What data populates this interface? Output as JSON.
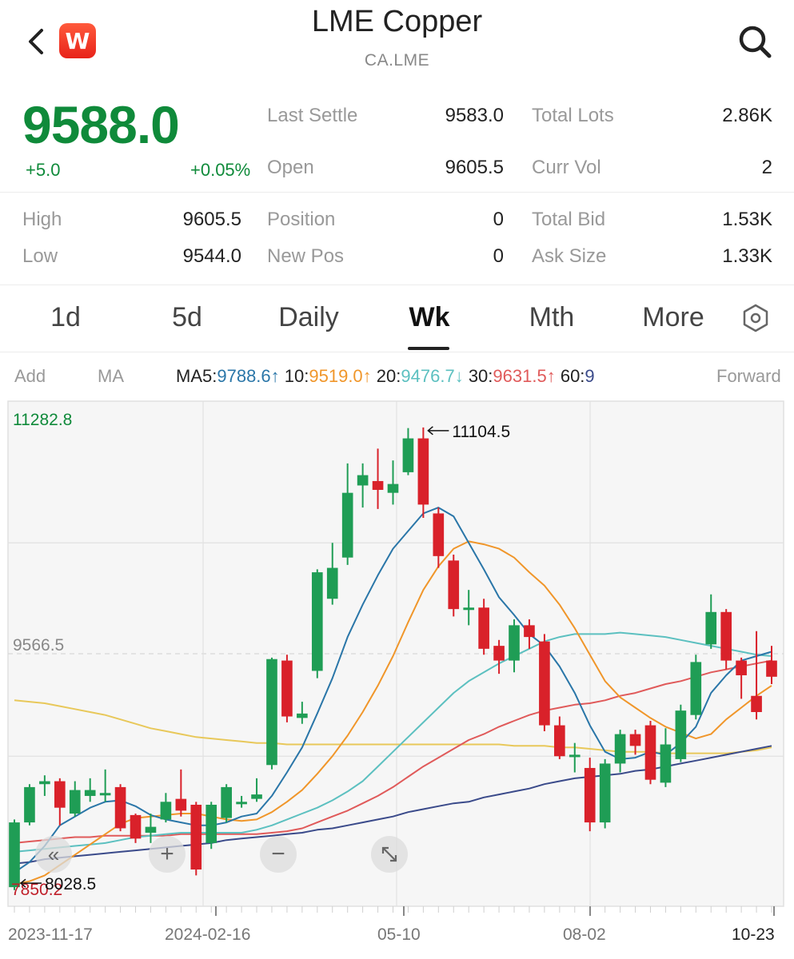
{
  "header": {
    "title": "LME Copper",
    "symbol": "CA.LME",
    "logo_letter": "W",
    "back_icon": "chevron-left-icon",
    "search_icon": "search-icon"
  },
  "quote": {
    "last_price": "9588.0",
    "change": "+5.0",
    "change_pct": "+0.05%",
    "price_color": "#0f8a3a"
  },
  "stats": {
    "last_settle_label": "Last Settle",
    "last_settle": "9583.0",
    "total_lots_label": "Total Lots",
    "total_lots": "2.86K",
    "open_label": "Open",
    "open": "9605.5",
    "curr_vol_label": "Curr Vol",
    "curr_vol": "2",
    "high_label": "High",
    "high": "9605.5",
    "position_label": "Position",
    "position": "0",
    "total_bid_label": "Total Bid",
    "total_bid": "1.53K",
    "low_label": "Low",
    "low": "9544.0",
    "new_pos_label": "New Pos",
    "new_pos": "0",
    "ask_size_label": "Ask Size",
    "ask_size": "1.33K"
  },
  "tabs": [
    "1d",
    "5d",
    "Daily",
    "Wk",
    "Mth",
    "More"
  ],
  "active_tab": "Wk",
  "ma_bar": {
    "add": "Add",
    "ma": "MA",
    "ma5_label": "MA5:",
    "ma5_value": "9788.6",
    "ma5_arrow": "↑",
    "ma10_label": "10:",
    "ma10_value": "9519.0",
    "ma10_arrow": "↑",
    "ma20_label": "20:",
    "ma20_value": "9476.7",
    "ma20_arrow": "↓",
    "ma30_label": "30:",
    "ma30_value": "9631.5",
    "ma30_arrow": "↑",
    "ma60_label": "60:",
    "ma60_value": "9",
    "forward": "Forward",
    "colors": {
      "ma5": "#2a76a8",
      "ma10": "#f0962a",
      "ma20": "#5cc0c0",
      "ma30": "#e05a5a",
      "ma60": "#3a4a8a",
      "ma_long": "#e8c85a"
    }
  },
  "chart_data": {
    "type": "candlestick",
    "ylim": [
      7850.2,
      11282.8
    ],
    "y_labels": {
      "top": "11282.8",
      "mid": "9566.5",
      "bottom": "7850.2"
    },
    "max_label": "11104.5",
    "min_label": "8028.5",
    "x_labels": [
      "2023-11-17",
      "2024-02-16",
      "05-10",
      "08-02",
      "10-23"
    ],
    "up_color": "#1f9d55",
    "down_color": "#d9212a",
    "candles": [
      {
        "o": 7980,
        "c": 8420,
        "h": 8440,
        "l": 7960
      },
      {
        "o": 8420,
        "c": 8660,
        "h": 8680,
        "l": 8400
      },
      {
        "o": 8680,
        "c": 8700,
        "h": 8740,
        "l": 8600
      },
      {
        "o": 8700,
        "c": 8520,
        "h": 8720,
        "l": 8400
      },
      {
        "o": 8480,
        "c": 8640,
        "h": 8700,
        "l": 8460
      },
      {
        "o": 8600,
        "c": 8640,
        "h": 8720,
        "l": 8560
      },
      {
        "o": 8620,
        "c": 8620,
        "h": 8780,
        "l": 8560
      },
      {
        "o": 8660,
        "c": 8380,
        "h": 8680,
        "l": 8360
      },
      {
        "o": 8470,
        "c": 8310,
        "h": 8480,
        "l": 8280
      },
      {
        "o": 8350,
        "c": 8390,
        "h": 8480,
        "l": 8280
      },
      {
        "o": 8440,
        "c": 8560,
        "h": 8620,
        "l": 8420
      },
      {
        "o": 8580,
        "c": 8500,
        "h": 8780,
        "l": 8460
      },
      {
        "o": 8540,
        "c": 8100,
        "h": 8560,
        "l": 8060
      },
      {
        "o": 8280,
        "c": 8540,
        "h": 8560,
        "l": 8240
      },
      {
        "o": 8450,
        "c": 8660,
        "h": 8680,
        "l": 8420
      },
      {
        "o": 8560,
        "c": 8560,
        "h": 8600,
        "l": 8520
      },
      {
        "o": 8580,
        "c": 8610,
        "h": 8720,
        "l": 8560
      },
      {
        "o": 8810,
        "c": 9530,
        "h": 9540,
        "l": 8780
      },
      {
        "o": 9520,
        "c": 9140,
        "h": 9560,
        "l": 9100
      },
      {
        "o": 9130,
        "c": 9160,
        "h": 9240,
        "l": 9090
      },
      {
        "o": 9450,
        "c": 10120,
        "h": 10140,
        "l": 9400
      },
      {
        "o": 9940,
        "c": 10150,
        "h": 10320,
        "l": 9900
      },
      {
        "o": 10220,
        "c": 10660,
        "h": 10860,
        "l": 10170
      },
      {
        "o": 10710,
        "c": 10780,
        "h": 10860,
        "l": 10560
      },
      {
        "o": 10740,
        "c": 10680,
        "h": 10960,
        "l": 10550
      },
      {
        "o": 10660,
        "c": 10720,
        "h": 10880,
        "l": 10580
      },
      {
        "o": 10800,
        "c": 11030,
        "h": 11100,
        "l": 10780
      },
      {
        "o": 11030,
        "c": 10580,
        "h": 11104.5,
        "l": 10490
      },
      {
        "o": 10520,
        "c": 10230,
        "h": 10560,
        "l": 10150
      },
      {
        "o": 10200,
        "c": 9870,
        "h": 10240,
        "l": 9820
      },
      {
        "o": 9880,
        "c": 9880,
        "h": 10000,
        "l": 9760
      },
      {
        "o": 9880,
        "c": 9600,
        "h": 9940,
        "l": 9560
      },
      {
        "o": 9620,
        "c": 9520,
        "h": 9660,
        "l": 9430
      },
      {
        "o": 9520,
        "c": 9760,
        "h": 9800,
        "l": 9440
      },
      {
        "o": 9760,
        "c": 9680,
        "h": 9800,
        "l": 9600
      },
      {
        "o": 9650,
        "c": 9080,
        "h": 9700,
        "l": 9040
      },
      {
        "o": 9080,
        "c": 8870,
        "h": 9140,
        "l": 8850
      },
      {
        "o": 8880,
        "c": 8880,
        "h": 8960,
        "l": 8760
      },
      {
        "o": 8790,
        "c": 8420,
        "h": 8860,
        "l": 8360
      },
      {
        "o": 8420,
        "c": 8820,
        "h": 8850,
        "l": 8380
      },
      {
        "o": 8820,
        "c": 9020,
        "h": 9050,
        "l": 8760
      },
      {
        "o": 9020,
        "c": 8940,
        "h": 9050,
        "l": 8880
      },
      {
        "o": 9080,
        "c": 8710,
        "h": 9110,
        "l": 8680
      },
      {
        "o": 8690,
        "c": 8950,
        "h": 9060,
        "l": 8660
      },
      {
        "o": 8850,
        "c": 9180,
        "h": 9220,
        "l": 8830
      },
      {
        "o": 9150,
        "c": 9510,
        "h": 9560,
        "l": 9120
      },
      {
        "o": 9630,
        "c": 9850,
        "h": 9970,
        "l": 9600
      },
      {
        "o": 9850,
        "c": 9520,
        "h": 9870,
        "l": 9460
      },
      {
        "o": 9520,
        "c": 9420,
        "h": 9540,
        "l": 9260
      },
      {
        "o": 9280,
        "c": 9170,
        "h": 9720,
        "l": 9120
      },
      {
        "o": 9520,
        "c": 9410,
        "h": 9620,
        "l": 9360
      }
    ],
    "ma5": [
      8080,
      8150,
      8260,
      8400,
      8460,
      8520,
      8560,
      8570,
      8530,
      8470,
      8440,
      8420,
      8400,
      8400,
      8420,
      8460,
      8480,
      8600,
      8760,
      8930,
      9160,
      9400,
      9680,
      9900,
      10100,
      10280,
      10400,
      10520,
      10560,
      10500,
      10320,
      10140,
      9950,
      9830,
      9700,
      9620,
      9480,
      9300,
      9080,
      8900,
      8850,
      8860,
      8900,
      8880,
      8960,
      9070,
      9300,
      9420,
      9520,
      9550,
      9580
    ],
    "ma10": [
      8000,
      8020,
      8060,
      8130,
      8200,
      8270,
      8340,
      8410,
      8450,
      8460,
      8470,
      8480,
      8480,
      8460,
      8440,
      8430,
      8440,
      8490,
      8560,
      8640,
      8750,
      8870,
      9010,
      9170,
      9350,
      9550,
      9780,
      10000,
      10160,
      10280,
      10330,
      10310,
      10280,
      10220,
      10120,
      10030,
      9900,
      9740,
      9560,
      9380,
      9270,
      9200,
      9130,
      9070,
      9030,
      8990,
      9020,
      9120,
      9200,
      9280,
      9350
    ],
    "ma20": [
      8220,
      8230,
      8240,
      8250,
      8260,
      8270,
      8280,
      8300,
      8320,
      8330,
      8340,
      8350,
      8350,
      8350,
      8350,
      8350,
      8370,
      8400,
      8440,
      8480,
      8520,
      8570,
      8630,
      8700,
      8800,
      8900,
      9000,
      9100,
      9200,
      9300,
      9380,
      9440,
      9500,
      9550,
      9600,
      9650,
      9680,
      9700,
      9700,
      9700,
      9710,
      9700,
      9690,
      9680,
      9660,
      9640,
      9620,
      9600,
      9580,
      9560,
      9550
    ],
    "ma30": [
      8280,
      8290,
      8300,
      8310,
      8320,
      8320,
      8330,
      8330,
      8330,
      8330,
      8330,
      8340,
      8340,
      8340,
      8340,
      8340,
      8340,
      8350,
      8360,
      8380,
      8420,
      8460,
      8500,
      8550,
      8600,
      8660,
      8730,
      8800,
      8860,
      8920,
      8980,
      9020,
      9070,
      9110,
      9150,
      9180,
      9200,
      9220,
      9230,
      9250,
      9280,
      9300,
      9330,
      9360,
      9380,
      9410,
      9440,
      9460,
      9480,
      9500,
      9520
    ],
    "ma60": [
      8140,
      8150,
      8170,
      8180,
      8190,
      8200,
      8210,
      8220,
      8230,
      8240,
      8250,
      8260,
      8270,
      8280,
      8300,
      8310,
      8320,
      8330,
      8340,
      8350,
      8370,
      8380,
      8400,
      8420,
      8440,
      8460,
      8490,
      8510,
      8530,
      8550,
      8560,
      8590,
      8610,
      8630,
      8650,
      8680,
      8700,
      8720,
      8730,
      8740,
      8750,
      8770,
      8780,
      8800,
      8820,
      8840,
      8860,
      8880,
      8900,
      8920,
      8940
    ],
    "ma_long": [
      9250,
      9240,
      9230,
      9210,
      9190,
      9170,
      9150,
      9120,
      9090,
      9060,
      9040,
      9020,
      9000,
      8990,
      8980,
      8970,
      8960,
      8960,
      8950,
      8950,
      8950,
      8950,
      8950,
      8950,
      8950,
      8950,
      8950,
      8950,
      8950,
      8950,
      8950,
      8950,
      8950,
      8940,
      8940,
      8940,
      8930,
      8930,
      8920,
      8910,
      8900,
      8900,
      8900,
      8890,
      8890,
      8890,
      8890,
      8890,
      8900,
      8910,
      8930
    ]
  }
}
